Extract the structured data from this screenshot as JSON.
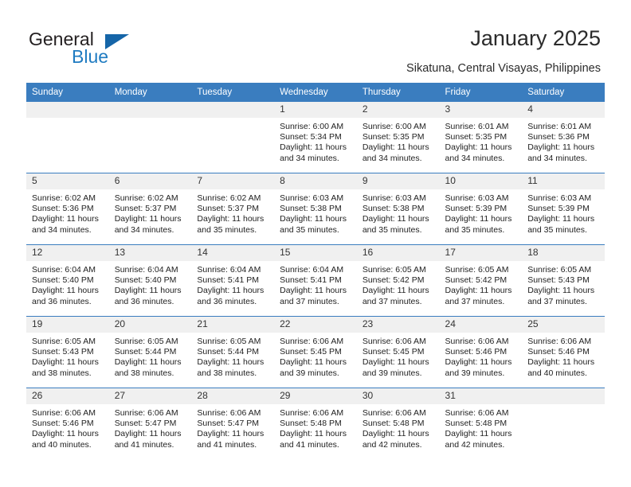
{
  "brand": {
    "name_part1": "General",
    "name_part2": "Blue",
    "accent_color": "#1f7bc1"
  },
  "header": {
    "title": "January 2025",
    "subtitle": "Sikatuna, Central Visayas, Philippines"
  },
  "theme": {
    "header_bg": "#3a7dbf",
    "daynum_bg": "#f0f0f0",
    "grid_line": "#3a7dbf"
  },
  "weekdays": [
    "Sunday",
    "Monday",
    "Tuesday",
    "Wednesday",
    "Thursday",
    "Friday",
    "Saturday"
  ],
  "weeks": [
    [
      {
        "day": "",
        "blank": true
      },
      {
        "day": "",
        "blank": true
      },
      {
        "day": "",
        "blank": true
      },
      {
        "day": "1",
        "sunrise": "Sunrise: 6:00 AM",
        "sunset": "Sunset: 5:34 PM",
        "daylight1": "Daylight: 11 hours",
        "daylight2": "and 34 minutes."
      },
      {
        "day": "2",
        "sunrise": "Sunrise: 6:00 AM",
        "sunset": "Sunset: 5:35 PM",
        "daylight1": "Daylight: 11 hours",
        "daylight2": "and 34 minutes."
      },
      {
        "day": "3",
        "sunrise": "Sunrise: 6:01 AM",
        "sunset": "Sunset: 5:35 PM",
        "daylight1": "Daylight: 11 hours",
        "daylight2": "and 34 minutes."
      },
      {
        "day": "4",
        "sunrise": "Sunrise: 6:01 AM",
        "sunset": "Sunset: 5:36 PM",
        "daylight1": "Daylight: 11 hours",
        "daylight2": "and 34 minutes."
      }
    ],
    [
      {
        "day": "5",
        "sunrise": "Sunrise: 6:02 AM",
        "sunset": "Sunset: 5:36 PM",
        "daylight1": "Daylight: 11 hours",
        "daylight2": "and 34 minutes."
      },
      {
        "day": "6",
        "sunrise": "Sunrise: 6:02 AM",
        "sunset": "Sunset: 5:37 PM",
        "daylight1": "Daylight: 11 hours",
        "daylight2": "and 34 minutes."
      },
      {
        "day": "7",
        "sunrise": "Sunrise: 6:02 AM",
        "sunset": "Sunset: 5:37 PM",
        "daylight1": "Daylight: 11 hours",
        "daylight2": "and 35 minutes."
      },
      {
        "day": "8",
        "sunrise": "Sunrise: 6:03 AM",
        "sunset": "Sunset: 5:38 PM",
        "daylight1": "Daylight: 11 hours",
        "daylight2": "and 35 minutes."
      },
      {
        "day": "9",
        "sunrise": "Sunrise: 6:03 AM",
        "sunset": "Sunset: 5:38 PM",
        "daylight1": "Daylight: 11 hours",
        "daylight2": "and 35 minutes."
      },
      {
        "day": "10",
        "sunrise": "Sunrise: 6:03 AM",
        "sunset": "Sunset: 5:39 PM",
        "daylight1": "Daylight: 11 hours",
        "daylight2": "and 35 minutes."
      },
      {
        "day": "11",
        "sunrise": "Sunrise: 6:03 AM",
        "sunset": "Sunset: 5:39 PM",
        "daylight1": "Daylight: 11 hours",
        "daylight2": "and 35 minutes."
      }
    ],
    [
      {
        "day": "12",
        "sunrise": "Sunrise: 6:04 AM",
        "sunset": "Sunset: 5:40 PM",
        "daylight1": "Daylight: 11 hours",
        "daylight2": "and 36 minutes."
      },
      {
        "day": "13",
        "sunrise": "Sunrise: 6:04 AM",
        "sunset": "Sunset: 5:40 PM",
        "daylight1": "Daylight: 11 hours",
        "daylight2": "and 36 minutes."
      },
      {
        "day": "14",
        "sunrise": "Sunrise: 6:04 AM",
        "sunset": "Sunset: 5:41 PM",
        "daylight1": "Daylight: 11 hours",
        "daylight2": "and 36 minutes."
      },
      {
        "day": "15",
        "sunrise": "Sunrise: 6:04 AM",
        "sunset": "Sunset: 5:41 PM",
        "daylight1": "Daylight: 11 hours",
        "daylight2": "and 37 minutes."
      },
      {
        "day": "16",
        "sunrise": "Sunrise: 6:05 AM",
        "sunset": "Sunset: 5:42 PM",
        "daylight1": "Daylight: 11 hours",
        "daylight2": "and 37 minutes."
      },
      {
        "day": "17",
        "sunrise": "Sunrise: 6:05 AM",
        "sunset": "Sunset: 5:42 PM",
        "daylight1": "Daylight: 11 hours",
        "daylight2": "and 37 minutes."
      },
      {
        "day": "18",
        "sunrise": "Sunrise: 6:05 AM",
        "sunset": "Sunset: 5:43 PM",
        "daylight1": "Daylight: 11 hours",
        "daylight2": "and 37 minutes."
      }
    ],
    [
      {
        "day": "19",
        "sunrise": "Sunrise: 6:05 AM",
        "sunset": "Sunset: 5:43 PM",
        "daylight1": "Daylight: 11 hours",
        "daylight2": "and 38 minutes."
      },
      {
        "day": "20",
        "sunrise": "Sunrise: 6:05 AM",
        "sunset": "Sunset: 5:44 PM",
        "daylight1": "Daylight: 11 hours",
        "daylight2": "and 38 minutes."
      },
      {
        "day": "21",
        "sunrise": "Sunrise: 6:05 AM",
        "sunset": "Sunset: 5:44 PM",
        "daylight1": "Daylight: 11 hours",
        "daylight2": "and 38 minutes."
      },
      {
        "day": "22",
        "sunrise": "Sunrise: 6:06 AM",
        "sunset": "Sunset: 5:45 PM",
        "daylight1": "Daylight: 11 hours",
        "daylight2": "and 39 minutes."
      },
      {
        "day": "23",
        "sunrise": "Sunrise: 6:06 AM",
        "sunset": "Sunset: 5:45 PM",
        "daylight1": "Daylight: 11 hours",
        "daylight2": "and 39 minutes."
      },
      {
        "day": "24",
        "sunrise": "Sunrise: 6:06 AM",
        "sunset": "Sunset: 5:46 PM",
        "daylight1": "Daylight: 11 hours",
        "daylight2": "and 39 minutes."
      },
      {
        "day": "25",
        "sunrise": "Sunrise: 6:06 AM",
        "sunset": "Sunset: 5:46 PM",
        "daylight1": "Daylight: 11 hours",
        "daylight2": "and 40 minutes."
      }
    ],
    [
      {
        "day": "26",
        "sunrise": "Sunrise: 6:06 AM",
        "sunset": "Sunset: 5:46 PM",
        "daylight1": "Daylight: 11 hours",
        "daylight2": "and 40 minutes."
      },
      {
        "day": "27",
        "sunrise": "Sunrise: 6:06 AM",
        "sunset": "Sunset: 5:47 PM",
        "daylight1": "Daylight: 11 hours",
        "daylight2": "and 41 minutes."
      },
      {
        "day": "28",
        "sunrise": "Sunrise: 6:06 AM",
        "sunset": "Sunset: 5:47 PM",
        "daylight1": "Daylight: 11 hours",
        "daylight2": "and 41 minutes."
      },
      {
        "day": "29",
        "sunrise": "Sunrise: 6:06 AM",
        "sunset": "Sunset: 5:48 PM",
        "daylight1": "Daylight: 11 hours",
        "daylight2": "and 41 minutes."
      },
      {
        "day": "30",
        "sunrise": "Sunrise: 6:06 AM",
        "sunset": "Sunset: 5:48 PM",
        "daylight1": "Daylight: 11 hours",
        "daylight2": "and 42 minutes."
      },
      {
        "day": "31",
        "sunrise": "Sunrise: 6:06 AM",
        "sunset": "Sunset: 5:48 PM",
        "daylight1": "Daylight: 11 hours",
        "daylight2": "and 42 minutes."
      },
      {
        "day": "",
        "blank": true
      }
    ]
  ]
}
